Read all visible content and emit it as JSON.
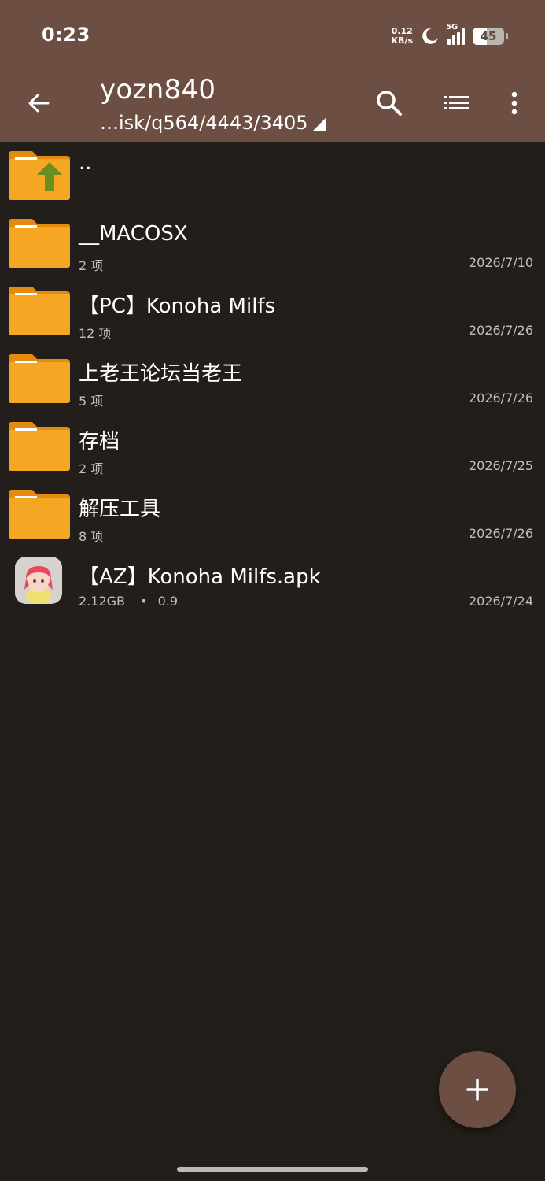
{
  "status_bar": {
    "time": "0:23",
    "net_speed_value": "0.12",
    "net_speed_unit": "KB/s",
    "network_type": "5G",
    "battery_level": "45",
    "battery_fraction": 0.45
  },
  "app_bar": {
    "title": "yozn840",
    "path": "…isk/q564/4443/3405",
    "icons": [
      "back-arrow-icon",
      "search-icon",
      "list-view-icon",
      "more-vert-icon"
    ]
  },
  "files": [
    {
      "name": "..",
      "type": "parent"
    },
    {
      "name": "__MACOSX",
      "meta": "2 项",
      "date": "2026/7/10",
      "type": "folder"
    },
    {
      "name": "【PC】Konoha Milfs",
      "meta": "12 项",
      "date": "2026/7/26",
      "type": "folder"
    },
    {
      "name": "上老王论坛当老王",
      "meta": "5 项",
      "date": "2026/7/26",
      "type": "folder"
    },
    {
      "name": "存档",
      "meta": "2 项",
      "date": "2026/7/25",
      "type": "folder"
    },
    {
      "name": "解压工具",
      "meta": "8 项",
      "date": "2026/7/26",
      "type": "folder"
    },
    {
      "name": "【AZ】Konoha Milfs.apk",
      "meta": "2.12GB",
      "version": "0.9",
      "date": "2026/7/24",
      "type": "apk"
    }
  ],
  "fab": {
    "icon": "plus-icon"
  },
  "colors": {
    "bar": "#6d4e43",
    "background": "#221e19",
    "folder": "#f5a623",
    "folder_tab": "#e58a10",
    "up_arrow": "#6a8f1c"
  }
}
